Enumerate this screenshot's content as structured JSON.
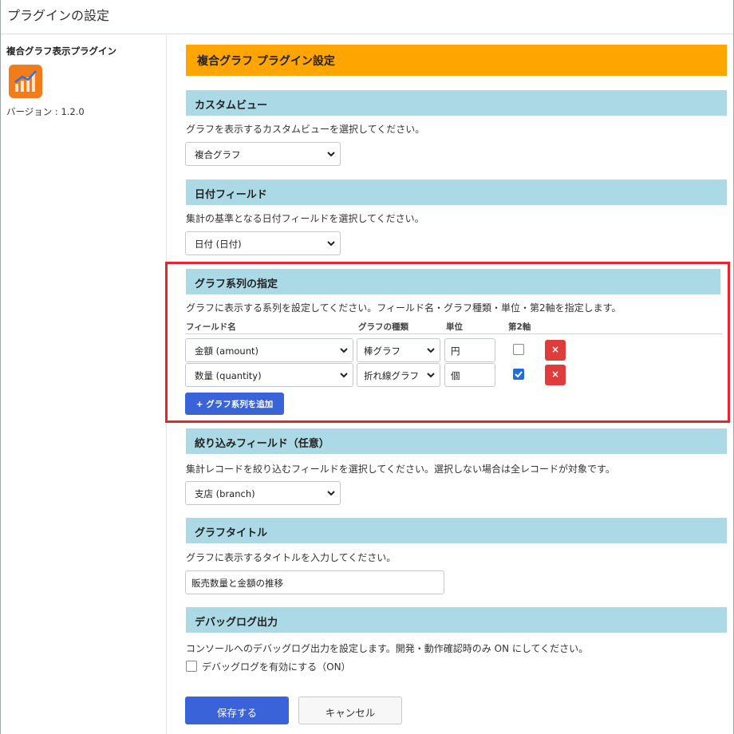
{
  "window": {
    "title": "プラグインの設定"
  },
  "sidebar": {
    "plugin_name": "複合グラフ表示プラグイン",
    "version_label": "バージョン : 1.2.0",
    "icon": "bar-line-chart-icon"
  },
  "main": {
    "title": "複合グラフ プラグイン設定",
    "title_color": "#ffa500"
  },
  "custom_view": {
    "heading": "カスタムビュー",
    "description": "グラフを表示するカスタムビューを選択してください。",
    "selected": "複合グラフ"
  },
  "date_field": {
    "heading": "日付フィールド",
    "description": "集計の基準となる日付フィールドを選択してください。",
    "selected": "日付 (日付)"
  },
  "series": {
    "heading": "グラフ系列の指定",
    "description": "グラフに表示する系列を設定してください。フィールド名・グラフ種類・単位・第2軸を指定します。",
    "columns": {
      "field": "フィールド名",
      "type": "グラフの種類",
      "unit": "単位",
      "axis2": "第2軸"
    },
    "rows": [
      {
        "field": "金額 (amount)",
        "type": "棒グラフ",
        "unit": "円",
        "axis2": false,
        "delete_label": "×"
      },
      {
        "field": "数量 (quantity)",
        "type": "折れ線グラフ",
        "unit": "個",
        "axis2": true,
        "delete_label": "×"
      }
    ],
    "add_label": "+ グラフ系列を追加"
  },
  "filter_field": {
    "heading": "絞り込みフィールド（任意）",
    "description": "集計レコードを絞り込むフィールドを選択してください。選択しない場合は全レコードが対象です。",
    "selected": "支店 (branch)"
  },
  "graph_title": {
    "heading": "グラフタイトル",
    "description": "グラフに表示するタイトルを入力してください。",
    "value": "販売数量と金額の推移"
  },
  "debug": {
    "heading": "デバッグログ出力",
    "description": "コンソールへのデバッグログ出力を設定します。開発・動作確認時のみ ON にしてください。",
    "checkbox_label": "デバッグログを有効にする（ON）",
    "checked": false
  },
  "actions": {
    "save_label": "保存する",
    "cancel_label": "キャンセル"
  },
  "colors": {
    "accent_blue": "#3a63d9",
    "section_header": "#acd9e6",
    "delete_red": "#e03c3c",
    "highlight_red": "#e3262f"
  }
}
